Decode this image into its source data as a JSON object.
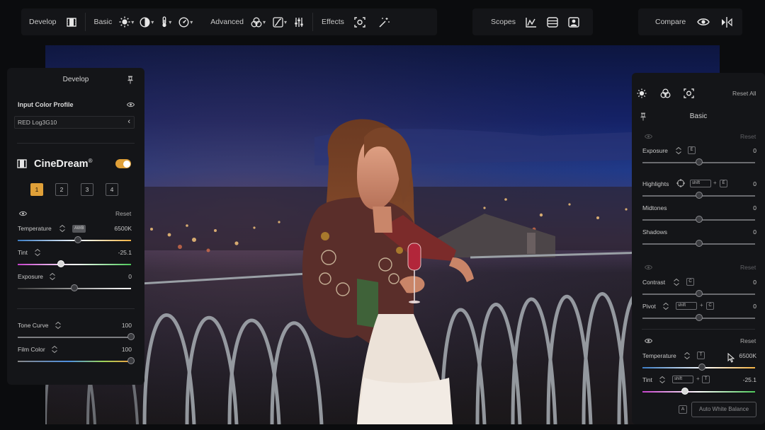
{
  "toolbar": {
    "develop": "Develop",
    "basic": "Basic",
    "advanced": "Advanced",
    "effects": "Effects",
    "scopes": "Scopes",
    "compare": "Compare"
  },
  "left_panel": {
    "title": "Develop",
    "input_profile_label": "Input Color Profile",
    "input_profile_value": "RED Log3G10",
    "brand_name": "CineDream",
    "brand_mark": "®",
    "presets": [
      "1",
      "2",
      "3",
      "4"
    ],
    "reset": "Reset",
    "temperature_label": "Temperature",
    "temperature_badge": "AWB",
    "temperature_value": "6500K",
    "temperature_level": 0.53,
    "tint_label": "Tint",
    "tint_value": "-25.1",
    "tint_level": 0.38,
    "exposure_label": "Exposure",
    "exposure_value": "0",
    "exposure_level": 0.5,
    "tone_curve_label": "Tone Curve",
    "tone_curve_value": "100",
    "tone_curve_level": 1.0,
    "film_color_label": "Film Color",
    "film_color_value": "100",
    "film_color_level": 1.0
  },
  "right_panel": {
    "reset_all": "Reset All",
    "title": "Basic",
    "reset": "Reset",
    "exposure_label": "Exposure",
    "exposure_key": "E",
    "exposure_value": "0",
    "highlights_label": "Highlights",
    "shift_key": "shift",
    "plus": "+",
    "highlights_key": "E",
    "highlights_value": "0",
    "midtones_label": "Midtones",
    "midtones_value": "0",
    "shadows_label": "Shadows",
    "shadows_value": "0",
    "contrast_label": "Contrast",
    "contrast_key": "C",
    "contrast_value": "0",
    "pivot_label": "Pivot",
    "pivot_key": "C",
    "pivot_value": "0",
    "temperature_label": "Temperature",
    "temperature_key": "T",
    "temperature_value": "6500K",
    "temperature_level": 0.53,
    "tint_label": "Tint",
    "tint_key": "T",
    "tint_value": "-25.1",
    "tint_level": 0.38,
    "awb_key": "A",
    "awb_button": "Auto White Balance"
  },
  "colors": {
    "accent": "#e0a038",
    "panel": "#141518",
    "background": "#0b0c0e"
  }
}
